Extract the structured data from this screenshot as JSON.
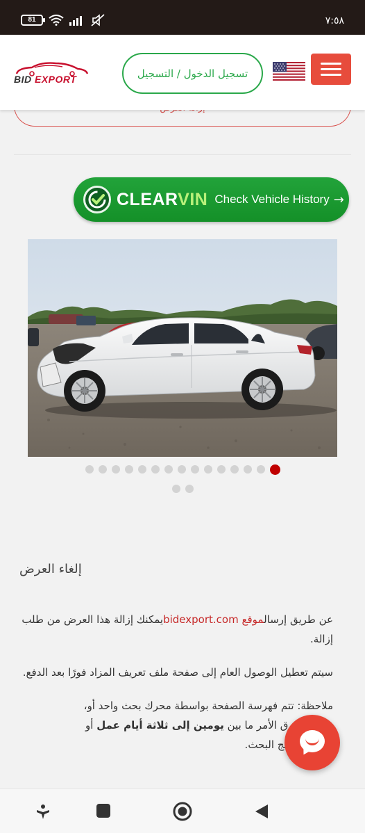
{
  "status_bar": {
    "battery": "81",
    "time": "٧:٥٨",
    "icons": [
      "wifi-icon",
      "signal-icon",
      "mute-icon"
    ]
  },
  "header": {
    "logo": {
      "text_main": "BID ",
      "text_accent": "EXPORT"
    },
    "login_label": "تسجيل الدخول / التسجيل",
    "flag": "us-flag-icon",
    "menu": "hamburger-menu-icon",
    "colors": {
      "accent": "#e74c3c",
      "green": "#2aa84a"
    }
  },
  "remove_button": {
    "label": "إزالة العرض"
  },
  "clearvin": {
    "brand_clear": "CLEAR",
    "brand_vin": "VIN",
    "tagline": "Check Vehicle History",
    "arrow": "→"
  },
  "gallery": {
    "total_images": 17,
    "active_index": 14
  },
  "content": {
    "heading": "إلغاء العرض",
    "p1_prefix": "عن طريق إرسال",
    "p1_link_word": "موقع",
    "p1_link": "bidexport.com",
    "p1_suffix": "يمكنك إزالة هذا العرض من طلب إزالة.",
    "p2": "سيتم تعطيل الوصول العام إلى صفحة ملف تعريف المزاد فورًا بعد الدفع.",
    "p3_part1": "ملاحظة: تتم فهرسة الصفحة بواسطة محرك بحث واحد أو",
    "p3_bold1": "ملاحظة",
    "p3_part2": "، وقد يستغرق الأمر ما بين ",
    "p3_bold2": "يومين إلى ثلاثة أيام عمل",
    "p3_part3": " أو أكثر من نتائج البحث."
  },
  "nav": {
    "icons": [
      "accessibility-icon",
      "recents-square-icon",
      "home-circle-icon",
      "back-triangle-icon"
    ]
  }
}
